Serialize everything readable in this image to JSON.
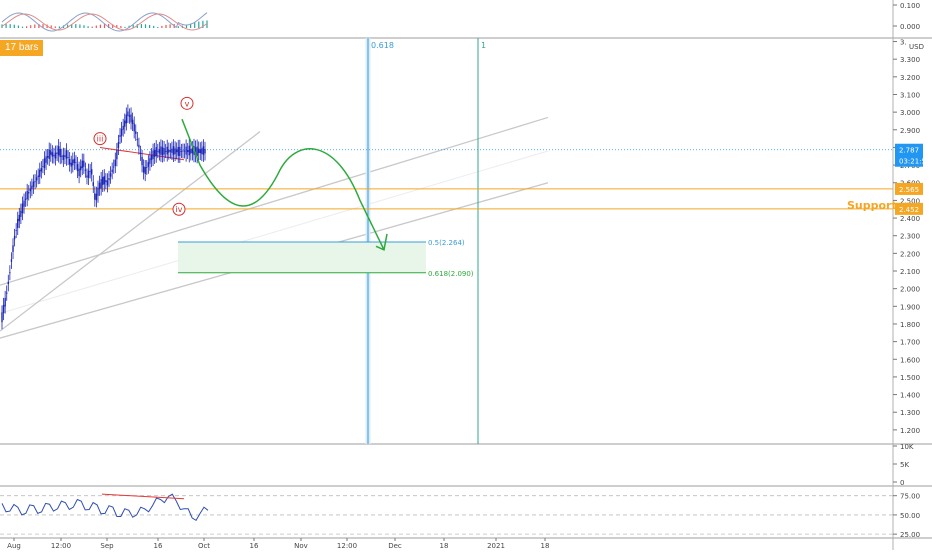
{
  "chart_data": {
    "type": "candlestick",
    "colors": {
      "candle": "#1a24b5",
      "fib_line": "#3a9bd9",
      "fib_line_green": "#2fa98c",
      "support": "#f5a623",
      "wave_label": "#d32f2f",
      "forecast": "#2eaa3c",
      "channel": "#c8c8c8",
      "price_line": "#2196f3",
      "rsi": "#2f4db3"
    },
    "price_axis": {
      "unit": "USD",
      "ticks": [
        "3.300",
        "3.200",
        "3.100",
        "3.000",
        "2.900",
        "2.800",
        "2.700",
        "2.600",
        "2.500",
        "2.400",
        "2.300",
        "2.200",
        "2.100",
        "2.000",
        "1.900",
        "1.800",
        "1.700",
        "1.600",
        "1.500",
        "1.400",
        "1.300",
        "1.200"
      ],
      "top_clipped_label": "3.",
      "ylim": [
        1.12,
        3.42
      ],
      "last_price": "2.787",
      "countdown": "03:21:54",
      "support_upper": "2.565",
      "support_lower": "2.452"
    },
    "time_axis": [
      "Aug",
      "12:00",
      "Sep",
      "16",
      "Oct",
      "16",
      "Nov",
      "12:00",
      "Dec",
      "18",
      "2021",
      "18"
    ],
    "wave_labels": [
      "iii",
      "iv",
      "v"
    ],
    "bars_badge": "17 bars",
    "support_label": "Support",
    "time_fib": [
      {
        "label": "0.618"
      },
      {
        "label": "1"
      }
    ],
    "fib_retracements": [
      {
        "label": "0.5(2.264)",
        "price": 2.264
      },
      {
        "label": "0.618(2.090)",
        "price": 2.09
      }
    ],
    "top_indicator": {
      "ticks": [
        "0.100",
        "0.000"
      ]
    },
    "volume_pane": {
      "ticks": [
        "10K",
        "5K",
        "0"
      ]
    },
    "rsi_pane": {
      "ticks": [
        "75.00",
        "50.00",
        "25.00"
      ]
    },
    "price_path": [
      [
        0.0,
        1.84
      ],
      [
        0.02,
        1.95
      ],
      [
        0.04,
        2.1
      ],
      [
        0.06,
        2.28
      ],
      [
        0.08,
        2.38
      ],
      [
        0.1,
        2.45
      ],
      [
        0.12,
        2.52
      ],
      [
        0.14,
        2.56
      ],
      [
        0.16,
        2.6
      ],
      [
        0.18,
        2.64
      ],
      [
        0.2,
        2.69
      ],
      [
        0.22,
        2.74
      ],
      [
        0.24,
        2.77
      ],
      [
        0.26,
        2.75
      ],
      [
        0.28,
        2.78
      ],
      [
        0.3,
        2.74
      ],
      [
        0.32,
        2.76
      ],
      [
        0.34,
        2.7
      ],
      [
        0.36,
        2.73
      ],
      [
        0.38,
        2.66
      ],
      [
        0.4,
        2.72
      ],
      [
        0.42,
        2.63
      ],
      [
        0.44,
        2.68
      ],
      [
        0.46,
        2.5
      ],
      [
        0.48,
        2.58
      ],
      [
        0.5,
        2.62
      ],
      [
        0.52,
        2.6
      ],
      [
        0.54,
        2.66
      ],
      [
        0.56,
        2.72
      ],
      [
        0.58,
        2.86
      ],
      [
        0.6,
        2.92
      ],
      [
        0.62,
        2.99
      ],
      [
        0.64,
        2.96
      ],
      [
        0.66,
        2.88
      ],
      [
        0.68,
        2.78
      ],
      [
        0.7,
        2.66
      ],
      [
        0.72,
        2.7
      ],
      [
        0.74,
        2.75
      ],
      [
        0.76,
        2.78
      ]
    ],
    "rsi_path": [
      [
        0.0,
        65
      ],
      [
        0.03,
        55
      ],
      [
        0.06,
        60
      ],
      [
        0.09,
        52
      ],
      [
        0.12,
        62
      ],
      [
        0.15,
        54
      ],
      [
        0.18,
        64
      ],
      [
        0.21,
        58
      ],
      [
        0.24,
        66
      ],
      [
        0.27,
        60
      ],
      [
        0.3,
        68
      ],
      [
        0.33,
        57
      ],
      [
        0.36,
        63
      ],
      [
        0.39,
        52
      ],
      [
        0.42,
        60
      ],
      [
        0.45,
        48
      ],
      [
        0.48,
        56
      ],
      [
        0.51,
        50
      ],
      [
        0.54,
        58
      ],
      [
        0.57,
        62
      ],
      [
        0.6,
        70
      ],
      [
        0.63,
        74
      ],
      [
        0.66,
        68
      ],
      [
        0.69,
        58
      ],
      [
        0.72,
        46
      ],
      [
        0.75,
        52
      ],
      [
        0.78,
        56
      ]
    ]
  }
}
